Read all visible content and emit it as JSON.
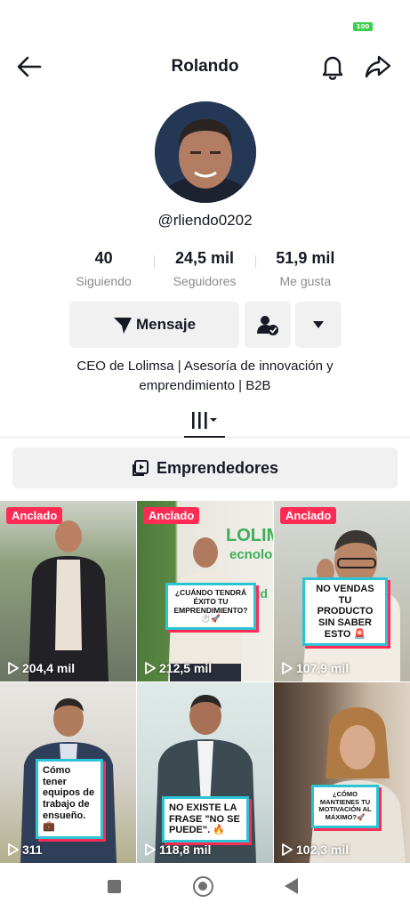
{
  "status": {
    "battery": "100"
  },
  "header": {
    "title": "Rolando",
    "back_icon": "back-arrow-icon",
    "bell_icon": "bell-icon",
    "share_icon": "share-icon"
  },
  "profile": {
    "username": "@rliendo0202",
    "stats": [
      {
        "value": "40",
        "label": "Siguiendo"
      },
      {
        "value": "24,5 mil",
        "label": "Seguidores"
      },
      {
        "value": "51,9 mil",
        "label": "Me gusta"
      }
    ],
    "message_label": "Mensaje",
    "bio_line1": "CEO de Lolimsa | Asesoría de innovación y",
    "bio_line2": "emprendimiento | B2B"
  },
  "playlist": {
    "label": "Emprendedores"
  },
  "pinned_label": "Anclado",
  "videos": [
    {
      "views": "204,4 mil",
      "pinned": true
    },
    {
      "views": "212,5 mil",
      "pinned": true,
      "caption": "¿CUÁNDO TENDRÁ ÉXITO TU EMPRENDIMIENTO? ⏱️🚀",
      "brand_text": "LOLIM",
      "brand_sub": "ecnolog",
      "brand_tail": "ud"
    },
    {
      "views": "107,9 mil",
      "pinned": true,
      "caption": "NO VENDAS TU PRODUCTO SIN SABER ESTO 🚨"
    },
    {
      "views": "311",
      "caption": "Cómo tener equipos de trabajo de ensueño. 💼"
    },
    {
      "views": "118,8 mil",
      "caption": "NO EXISTE LA FRASE \"NO SE PUEDE\". 🔥"
    },
    {
      "views": "102,3 mil",
      "caption": "¿CÓMO MANTIENES TU MOTIVACIÓN AL MÁXIMO?🚀"
    }
  ],
  "colors": {
    "accent": "#fe2c55",
    "caption_border": "#2cc4d4",
    "button_bg": "#f1f1f2"
  }
}
